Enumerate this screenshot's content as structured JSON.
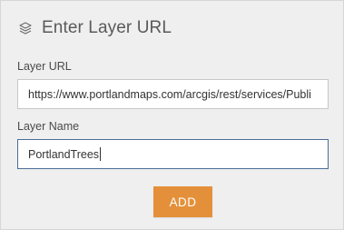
{
  "header": {
    "icon": "layers-icon",
    "title": "Enter Layer URL"
  },
  "form": {
    "url_label": "Layer URL",
    "url_value": "https://www.portlandmaps.com/arcgis/rest/services/Publi",
    "name_label": "Layer Name",
    "name_value": "PortlandTrees"
  },
  "actions": {
    "add_label": "ADD"
  },
  "colors": {
    "panel_bg": "#efefef",
    "button_accent": "#e4903a",
    "focus_border": "#4a6e96"
  }
}
